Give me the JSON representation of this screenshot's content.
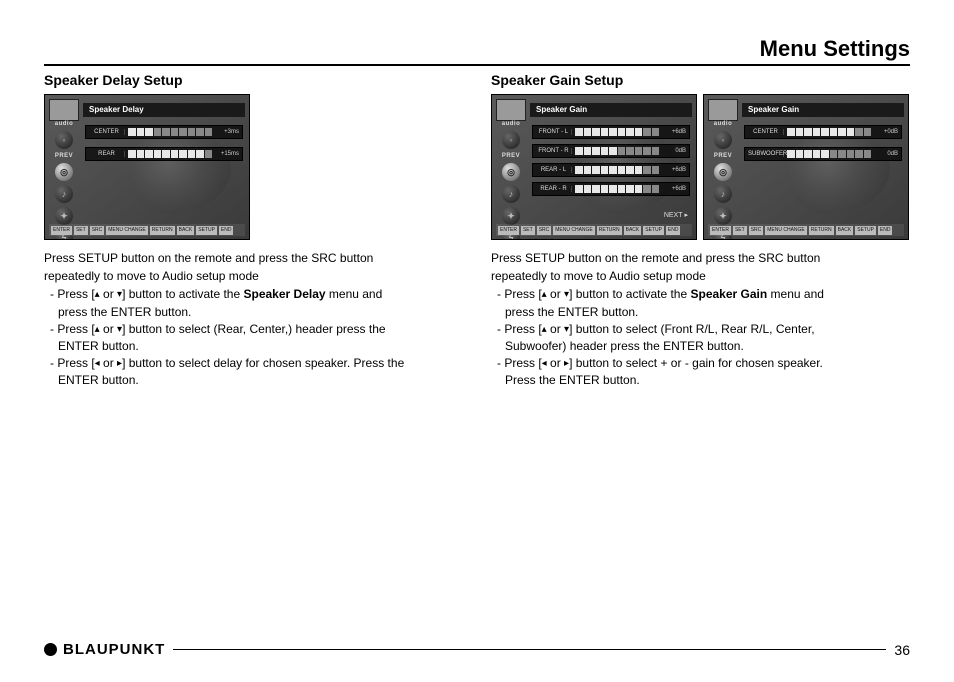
{
  "page": {
    "title": "Menu Settings",
    "number": "36",
    "brand": "BLAUPUNKT"
  },
  "arrows": {
    "up": "▴",
    "down": "▾",
    "left": "◂",
    "right": "▸"
  },
  "osd_footer": [
    "ENTER",
    "SET",
    "SRC",
    "MENU CHANGE",
    "RETURN",
    "BACK",
    "SETUP",
    "END"
  ],
  "osd_sidebar": {
    "audio": "audio",
    "prev": "PREV"
  },
  "osd_next": "NEXT",
  "left": {
    "heading": "Speaker Delay Setup",
    "osd_title": "Speaker Delay",
    "rows": [
      {
        "label": "CENTER",
        "segments": 10,
        "on": 3,
        "value": "+3ms"
      },
      {
        "label": "REAR",
        "segments": 10,
        "on": 9,
        "value": "+15ms"
      }
    ],
    "text_intro1": "Press SETUP button on the remote and press the SRC button",
    "text_intro2": "repeatedly to move to Audio setup mode",
    "b1a": "- Press [",
    "b1m": " or ",
    "b1b": "] button to activate the ",
    "b1bold": "Speaker Delay",
    "b1c": " menu and",
    "b1d": "press the ENTER button.",
    "b2a": "- Press [",
    "b2m": " or ",
    "b2b": "] button to select (Rear, Center,) header press the",
    "b2c": "ENTER button.",
    "b3a": "- Press [",
    "b3m": " or ",
    "b3b": "] button to select delay for chosen speaker. Press the",
    "b3c": "ENTER button."
  },
  "right": {
    "heading": "Speaker Gain Setup",
    "osd1_title": "Speaker Gain",
    "osd1_rows": [
      {
        "label": "FRONT - L",
        "value": "+6dB"
      },
      {
        "label": "FRONT - R",
        "value": "0dB"
      },
      {
        "label": "REAR - L",
        "value": "+6dB"
      },
      {
        "label": "REAR - R",
        "value": "+6dB"
      }
    ],
    "osd2_title": "Speaker Gain",
    "osd2_rows": [
      {
        "label": "CENTER",
        "value": "+0dB"
      },
      {
        "label": "SUBWOOFER",
        "value": "0dB"
      }
    ],
    "text_intro1": "Press SETUP button on the remote and press the SRC button",
    "text_intro2": "repeatedly to move to Audio setup mode",
    "b1a": "- Press [",
    "b1m": " or ",
    "b1b": "] button to activate the ",
    "b1bold": "Speaker Gain",
    "b1c": " menu and",
    "b1d": "press the ENTER button.",
    "b2a": "- Press [",
    "b2m": " or ",
    "b2b": "] button to select (Front R/L, Rear R/L, Center,",
    "b2c": "Subwoofer) header press the ENTER button.",
    "b3a": "- Press [",
    "b3m": " or ",
    "b3b": "] button to select + or - gain for chosen speaker.",
    "b3c": "Press the ENTER button."
  }
}
